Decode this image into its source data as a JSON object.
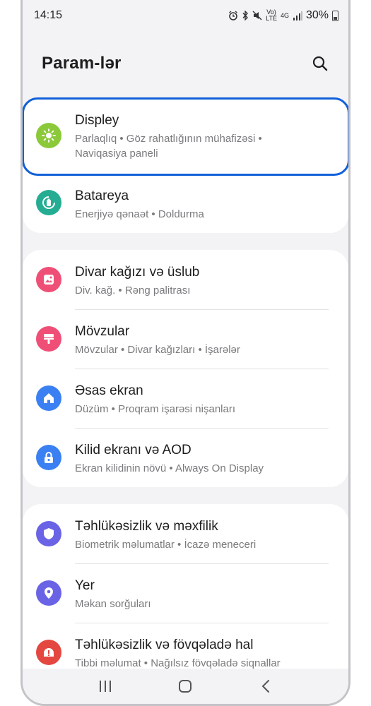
{
  "status": {
    "time": "14:15",
    "signal_label_top": "Vo)",
    "signal_label_bottom": "LTE",
    "network": "4G",
    "battery": "30%"
  },
  "header": {
    "title": "Param-lər"
  },
  "groups": [
    {
      "items": [
        {
          "title": "Displey",
          "sub1": "Parlaqlıq  •  Göz rahatlığının mühafizəsi  •",
          "sub2": "Naviqasiya paneli",
          "icon": "sun-icon",
          "color": "#8bc93a"
        },
        {
          "title": "Batareya",
          "sub1": "Enerjiyə qənaət  •  Doldurma",
          "icon": "battery-icon",
          "color": "#24ad92"
        }
      ]
    },
    {
      "items": [
        {
          "title": "Divar kağızı və üslub",
          "sub1": "Div. kağ.  •  Rəng palitrası",
          "icon": "wallpaper-icon",
          "color": "#ef4f76"
        },
        {
          "title": "Mövzular",
          "sub1": "Mövzular  •  Divar kağızları  •  İşarələr",
          "icon": "themes-icon",
          "color": "#ef4f76"
        },
        {
          "title": "Əsas ekran",
          "sub1": "Düzüm  •  Proqram işarəsi nişanları",
          "icon": "home-icon",
          "color": "#3b80f2"
        },
        {
          "title": "Kilid ekranı və AOD",
          "sub1": "Ekran kilidinin növü  •  Always On Display",
          "icon": "lock-icon",
          "color": "#3b80f2"
        }
      ]
    },
    {
      "items": [
        {
          "title": "Təhlükəsizlik və məxfilik",
          "sub1": "Biometrik məlumatlar  •  İcazə meneceri",
          "icon": "shield-icon",
          "color": "#6a63e6"
        },
        {
          "title": "Yer",
          "sub1": "Məkan sorğuları",
          "icon": "location-icon",
          "color": "#6a63e6"
        },
        {
          "title": "Təhlükəsizlik və fövqəladə hal",
          "sub1": "Tibbi məlumat  •  Nağılsız fövqəladə siqnallar",
          "icon": "emergency-icon",
          "color": "#e4473f"
        }
      ]
    }
  ]
}
